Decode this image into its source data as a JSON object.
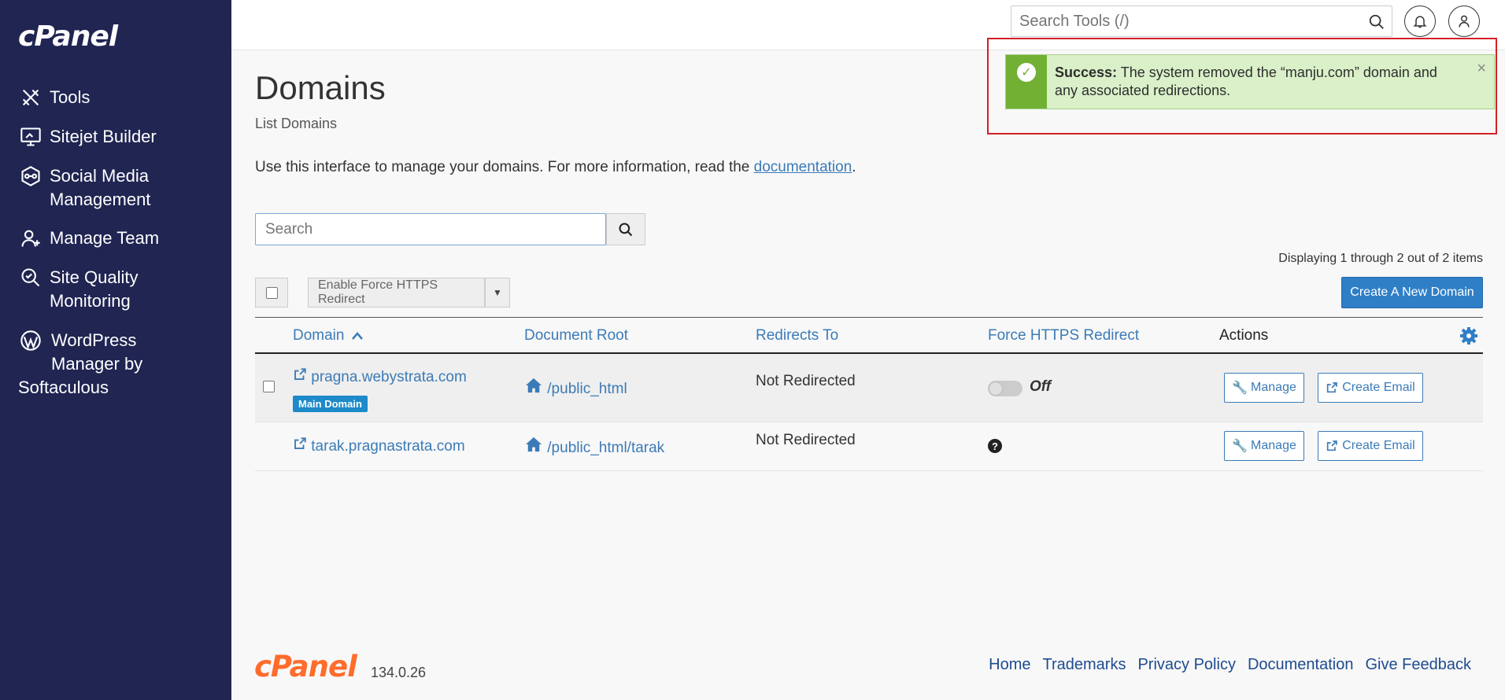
{
  "sidebar": {
    "logo": "cPanel",
    "items": [
      {
        "label_lines": [
          "Tools"
        ],
        "icon": "tools-icon"
      },
      {
        "label_lines": [
          "Sitejet Builder"
        ],
        "icon": "monitor-icon"
      },
      {
        "label_lines": [
          "Social Media",
          "Management"
        ],
        "icon": "social-icon"
      },
      {
        "label_lines": [
          "Manage Team"
        ],
        "icon": "user-add-icon"
      },
      {
        "label_lines": [
          "Site Quality",
          "Monitoring"
        ],
        "icon": "search-quality-icon"
      },
      {
        "label_lines": [
          "WordPress",
          "Manager by",
          "Softaculous"
        ],
        "icon": "wordpress-icon"
      }
    ]
  },
  "header": {
    "search_placeholder": "Search Tools (/)"
  },
  "toast": {
    "label": "Success:",
    "message": "The system removed the “manju.com” domain and any associated redirections.",
    "close": "×"
  },
  "page": {
    "title": "Domains",
    "subtitle": "List Domains",
    "intro_text": "Use this interface to manage your domains. For more information, read the ",
    "intro_link": "documentation",
    "intro_end": ".",
    "search_placeholder": "Search",
    "display_count": "Displaying 1 through 2 out of 2 items",
    "bulk_action": "Enable Force HTTPS Redirect",
    "create_button": "Create A New Domain"
  },
  "table": {
    "columns": [
      "Domain",
      "Document Root",
      "Redirects To",
      "Force HTTPS Redirect",
      "Actions"
    ],
    "sort_indicator": "^",
    "rows": [
      {
        "domain": "pragna.webystrata.com",
        "badge": "Main Domain",
        "doc_root": "/public_html",
        "redirects_to": "Not Redirected",
        "https_status": "Off",
        "manage": "Manage",
        "create_email": "Create Email"
      },
      {
        "domain": "tarak.pragnastrata.com",
        "badge": "",
        "doc_root": "/public_html/tarak",
        "redirects_to": "Not Redirected",
        "https_status": "?",
        "manage": "Manage",
        "create_email": "Create Email"
      }
    ]
  },
  "footer": {
    "logo": "cPanel",
    "version": "134.0.26",
    "links": [
      "Home",
      "Trademarks",
      "Privacy Policy",
      "Documentation",
      "Give Feedback"
    ]
  },
  "colors": {
    "sidebar_bg": "#202552",
    "link": "#3b7bb7",
    "primary_button": "#2f7fc7",
    "success_bar": "#72b034",
    "success_bg": "#d9f0c8",
    "brand_orange": "#ff6c2c",
    "badge": "#1d8ac9"
  }
}
